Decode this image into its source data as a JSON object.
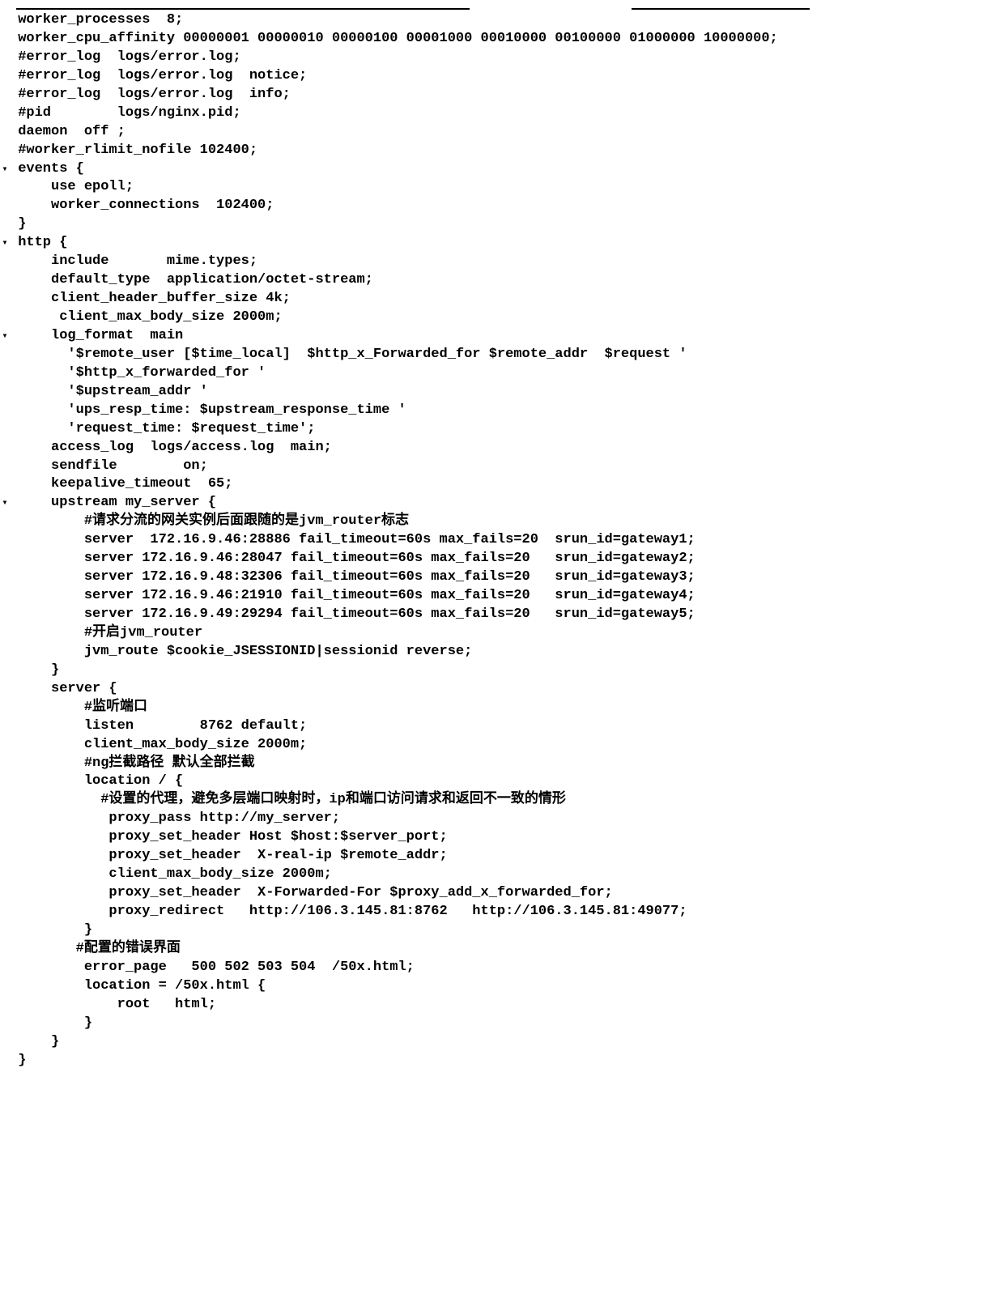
{
  "gutter": {
    "collapsed": "▸",
    "expanded": "▾",
    "none": ""
  },
  "lines": [
    {
      "g": "",
      "t": " worker_processes  8;"
    },
    {
      "g": "",
      "t": " worker_cpu_affinity 00000001 00000010 00000100 00001000 00010000 00100000 01000000 10000000;"
    },
    {
      "g": "",
      "t": " #error_log  logs/error.log;"
    },
    {
      "g": "",
      "t": " #error_log  logs/error.log  notice;"
    },
    {
      "g": "",
      "t": " #error_log  logs/error.log  info;"
    },
    {
      "g": "",
      "t": " #pid        logs/nginx.pid;"
    },
    {
      "g": "",
      "t": " daemon  off ;"
    },
    {
      "g": "",
      "t": " #worker_rlimit_nofile 102400;"
    },
    {
      "g": "▾",
      "t": " events {"
    },
    {
      "g": "",
      "t": "     use epoll;"
    },
    {
      "g": "",
      "t": "     worker_connections  102400;"
    },
    {
      "g": "",
      "t": " }"
    },
    {
      "g": "▾",
      "t": " http {"
    },
    {
      "g": "",
      "t": "     include       mime.types;"
    },
    {
      "g": "",
      "t": "     default_type  application/octet-stream;"
    },
    {
      "g": "",
      "t": "     client_header_buffer_size 4k;"
    },
    {
      "g": "",
      "t": "      client_max_body_size 2000m;"
    },
    {
      "g": "▾",
      "t": "     log_format  main"
    },
    {
      "g": "",
      "t": "       '$remote_user [$time_local]  $http_x_Forwarded_for $remote_addr  $request '"
    },
    {
      "g": "",
      "t": "       '$http_x_forwarded_for '"
    },
    {
      "g": "",
      "t": "       '$upstream_addr '"
    },
    {
      "g": "",
      "t": "       'ups_resp_time: $upstream_response_time '"
    },
    {
      "g": "",
      "t": "       'request_time: $request_time';"
    },
    {
      "g": "",
      "t": "     access_log  logs/access.log  main;"
    },
    {
      "g": "",
      "t": "     sendfile        on;"
    },
    {
      "g": "",
      "t": "     keepalive_timeout  65;"
    },
    {
      "g": "▾",
      "t": "     upstream my_server {"
    },
    {
      "g": "",
      "t": "         #请求分流的网关实例后面跟随的是jvm_router标志"
    },
    {
      "g": "",
      "t": "         server  172.16.9.46:28886 fail_timeout=60s max_fails=20  srun_id=gateway1;"
    },
    {
      "g": "",
      "t": "         server 172.16.9.46:28047 fail_timeout=60s max_fails=20   srun_id=gateway2;"
    },
    {
      "g": "",
      "t": "         server 172.16.9.48:32306 fail_timeout=60s max_fails=20   srun_id=gateway3;"
    },
    {
      "g": "",
      "t": "         server 172.16.9.46:21910 fail_timeout=60s max_fails=20   srun_id=gateway4;"
    },
    {
      "g": "",
      "t": "         server 172.16.9.49:29294 fail_timeout=60s max_fails=20   srun_id=gateway5;"
    },
    {
      "g": "",
      "t": "         #开启jvm_router"
    },
    {
      "g": "",
      "t": "         jvm_route $cookie_JSESSIONID|sessionid reverse;"
    },
    {
      "g": "",
      "t": "     }"
    },
    {
      "g": "",
      "t": ""
    },
    {
      "g": "",
      "t": ""
    },
    {
      "g": "",
      "t": ""
    },
    {
      "g": "",
      "t": "     server {"
    },
    {
      "g": "",
      "t": "         #监听端口"
    },
    {
      "g": "",
      "t": "         listen        8762 default;"
    },
    {
      "g": "",
      "t": "         client_max_body_size 2000m;"
    },
    {
      "g": "",
      "t": "         #ng拦截路径 默认全部拦截"
    },
    {
      "g": "",
      "t": "         location / {"
    },
    {
      "g": "",
      "t": "           #设置的代理，避免多层端口映射时，ip和端口访问请求和返回不一致的情形"
    },
    {
      "g": "",
      "t": "            proxy_pass http://my_server;"
    },
    {
      "g": "",
      "t": "            proxy_set_header Host $host:$server_port;"
    },
    {
      "g": "",
      "t": "            proxy_set_header  X-real-ip $remote_addr;"
    },
    {
      "g": "",
      "t": "            client_max_body_size 2000m;"
    },
    {
      "g": "",
      "t": "            proxy_set_header  X-Forwarded-For $proxy_add_x_forwarded_for;"
    },
    {
      "g": "",
      "t": "            proxy_redirect   http://106.3.145.81:8762   http://106.3.145.81:49077;"
    },
    {
      "g": "",
      "t": "         }"
    },
    {
      "g": "",
      "t": "        #配置的错误界面"
    },
    {
      "g": "",
      "t": "         error_page   500 502 503 504  /50x.html;"
    },
    {
      "g": "",
      "t": "         location = /50x.html {"
    },
    {
      "g": "",
      "t": "             root   html;"
    },
    {
      "g": "",
      "t": "         }"
    },
    {
      "g": "",
      "t": "     }"
    },
    {
      "g": "",
      "t": ""
    },
    {
      "g": "",
      "t": " }"
    }
  ]
}
